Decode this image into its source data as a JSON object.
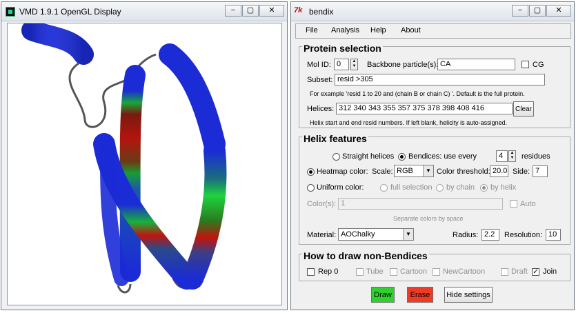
{
  "vmd": {
    "title": "VMD 1.9.1 OpenGL Display",
    "minimize": "−",
    "maximize": "▢",
    "close": "✕"
  },
  "bendix": {
    "title": "bendix",
    "minimize": "−",
    "maximize": "▢",
    "close": "✕",
    "menu": {
      "file": "File",
      "analysis": "Analysis",
      "help": "Help",
      "about": "About"
    },
    "protein": {
      "title": "Protein selection",
      "mol_id_label": "Mol ID:",
      "mol_id": "0",
      "backbone_label": "Backbone particle(s):",
      "backbone": "CA",
      "cg_label": "CG",
      "subset_label": "Subset:",
      "subset": "resid >305",
      "subset_hint": "For example 'resid 1 to 20 and (chain B or chain C) '. Default is the full protein.",
      "helices_label": "Helices:",
      "helices": "312 340 343 355 357 375 378 398 408 416",
      "clear": "Clear",
      "helices_hint": "Helix start and end resid numbers. If left blank, helicity is auto-assigned."
    },
    "features": {
      "title": "Helix features",
      "straight": "Straight helices",
      "bendices": "Bendices: use every",
      "every": "4",
      "residues": "residues",
      "heatmap": "Heatmap color:",
      "scale_label": "Scale:",
      "scale": "RGB",
      "threshold_label": "Color threshold:",
      "threshold": "20.0",
      "side_label": "Side:",
      "side": "7",
      "uniform": "Uniform color:",
      "full_selection": "full selection",
      "by_chain": "by chain",
      "by_helix": "by helix",
      "colors_label": "Color(s):",
      "colors": "1",
      "auto": "Auto",
      "colors_hint": "Separate colors by space",
      "material_label": "Material:",
      "material": "AOChalky",
      "radius_label": "Radius:",
      "radius": "2.2",
      "resolution_label": "Resolution:",
      "resolution": "10"
    },
    "nonbend": {
      "title": "How to draw non-Bendices",
      "rep0": "Rep 0",
      "tube": "Tube",
      "cartoon": "Cartoon",
      "newcartoon": "NewCartoon",
      "draft": "Draft",
      "join": "Join"
    },
    "actions": {
      "draw": "Draw",
      "erase": "Erase",
      "hide": "Hide settings",
      "draw_color": "#2fd12f",
      "erase_color": "#ef3a26"
    }
  }
}
